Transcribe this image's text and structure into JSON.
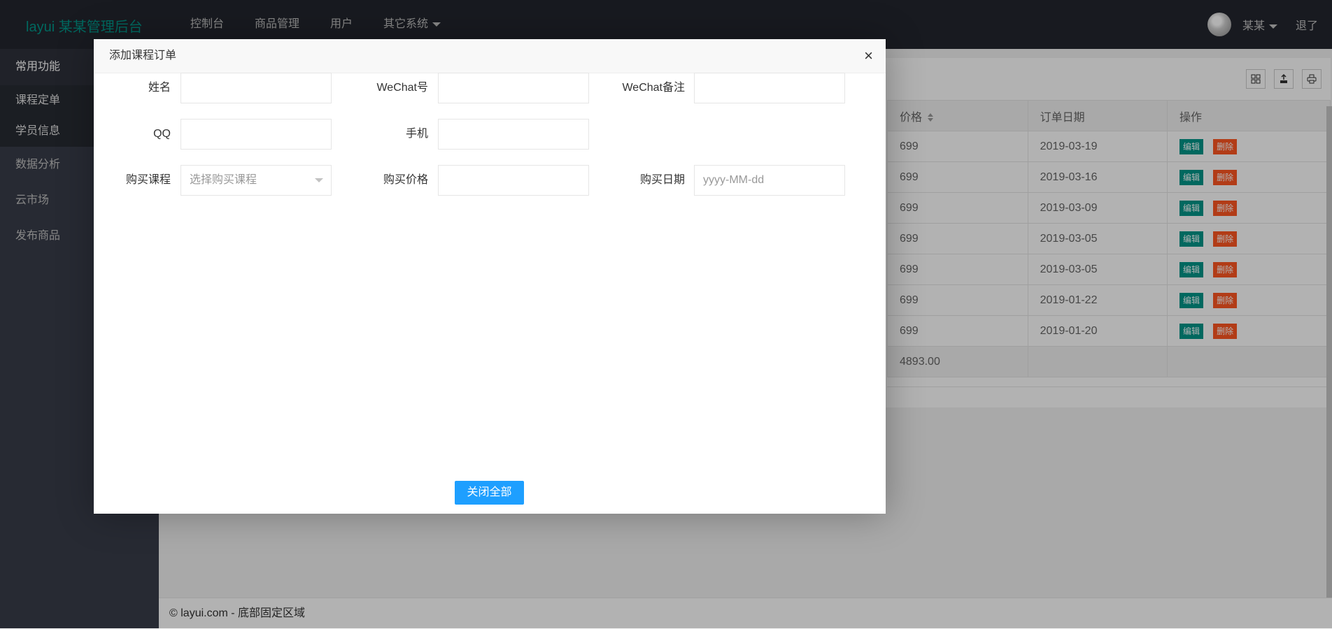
{
  "header": {
    "logo": "layui 某某管理后台",
    "nav": [
      {
        "label": "控制台"
      },
      {
        "label": "商品管理"
      },
      {
        "label": "用户"
      },
      {
        "label": "其它系统",
        "has_dropdown": true
      }
    ],
    "user_name": "某某",
    "logout": "退了"
  },
  "sidebar": {
    "group_title": "常用功能",
    "group_items": [
      {
        "label": "课程定单"
      },
      {
        "label": "学员信息"
      }
    ],
    "items": [
      {
        "label": "数据分析"
      },
      {
        "label": "云市场"
      },
      {
        "label": "发布商品"
      }
    ]
  },
  "table": {
    "headers": {
      "price": "价格",
      "date": "订单日期",
      "op": "操作"
    },
    "rows": [
      {
        "price": "699",
        "date": "2019-03-19"
      },
      {
        "price": "699",
        "date": "2019-03-16"
      },
      {
        "price": "699",
        "date": "2019-03-09"
      },
      {
        "price": "699",
        "date": "2019-03-05"
      },
      {
        "price": "699",
        "date": "2019-03-05"
      },
      {
        "price": "699",
        "date": "2019-01-22"
      },
      {
        "price": "699",
        "date": "2019-01-20"
      }
    ],
    "edit_label": "编辑",
    "delete_label": "删除",
    "total": "4893.00"
  },
  "footer": {
    "text": "© layui.com - 底部固定区域"
  },
  "modal": {
    "title": "添加课程订单",
    "close_icon": "×",
    "fields": {
      "name": {
        "label": "姓名",
        "value": ""
      },
      "wechat": {
        "label": "WeChat号",
        "value": ""
      },
      "wechat_note": {
        "label": "WeChat备注",
        "value": ""
      },
      "qq": {
        "label": "QQ",
        "value": ""
      },
      "phone": {
        "label": "手机",
        "value": ""
      },
      "course": {
        "label": "购买课程",
        "placeholder": "选择购买课程"
      },
      "price": {
        "label": "购买价格",
        "value": ""
      },
      "date": {
        "label": "购买日期",
        "placeholder": "yyyy-MM-dd"
      }
    },
    "close_all_button": "关闭全部"
  },
  "colors": {
    "header_bg": "#23262e",
    "sidebar_bg": "#393d49",
    "brand_green": "#009688",
    "danger": "#ff5722",
    "primary_blue": "#1e9fff"
  },
  "icons": [
    "avatar",
    "chevron-down-icon",
    "columns-icon",
    "export-icon",
    "print-icon",
    "close-icon",
    "sort-icon"
  ]
}
